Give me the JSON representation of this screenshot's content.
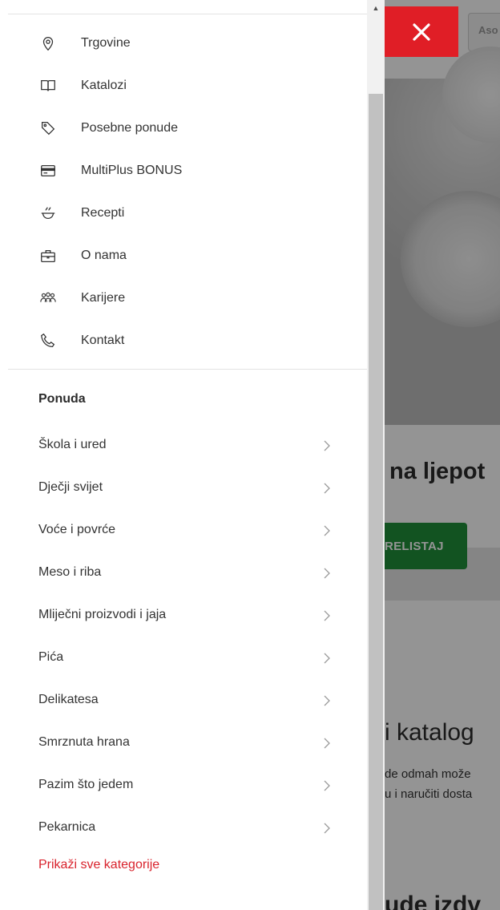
{
  "background_page": {
    "search_placeholder": "Aso",
    "heading_partial": "na ljepot",
    "green_button_label": "RELISTAJ",
    "catalog_heading_partial": "i katalog",
    "catalog_text_line1": "de odmah može",
    "catalog_text_line2": "u i naručiti dosta",
    "bottom_heading_partial": "ude izdv",
    "close_icon": "close-icon"
  },
  "menu": {
    "links": [
      {
        "label": "Trgovine",
        "icon": "location-pin-icon"
      },
      {
        "label": "Katalozi",
        "icon": "open-book-icon"
      },
      {
        "label": "Posebne ponude",
        "icon": "tag-icon"
      },
      {
        "label": "MultiPlus BONUS",
        "icon": "card-icon"
      },
      {
        "label": "Recepti",
        "icon": "cooking-pot-icon"
      },
      {
        "label": "O nama",
        "icon": "briefcase-icon"
      },
      {
        "label": "Karijere",
        "icon": "people-icon"
      },
      {
        "label": "Kontakt",
        "icon": "phone-icon"
      }
    ],
    "section_title": "Ponuda",
    "categories": [
      {
        "label": "Škola i ured"
      },
      {
        "label": "Dječji svijet"
      },
      {
        "label": "Voće i povrće"
      },
      {
        "label": "Meso i riba"
      },
      {
        "label": "Mliječni proizvodi i jaja"
      },
      {
        "label": "Pića"
      },
      {
        "label": "Delikatesa"
      },
      {
        "label": "Smrznuta hrana"
      },
      {
        "label": "Pazim što jedem"
      },
      {
        "label": "Pekarnica"
      }
    ],
    "show_all_label": "Prikaži sve kategorije"
  },
  "colors": {
    "accent_red": "#e01e26",
    "link_red": "#d9232d",
    "green_button": "#1f8f3a"
  }
}
